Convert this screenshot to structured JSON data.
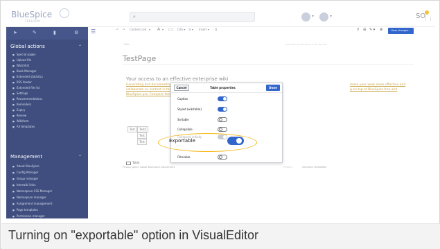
{
  "app": {
    "logo_text": "BlueSpice",
    "logo_subtext": "FREEDOM",
    "search_placeholder": "",
    "user_initials": "SO"
  },
  "sidebar": {
    "global_actions_heading": "Global actions",
    "global_items": [
      "Special pages",
      "Upload file",
      "Watchlist",
      "Book Manager",
      "Extended statistics",
      "RSS feeder",
      "Extended file list",
      "Settings",
      "Recommendations",
      "Reminders",
      "Expiry",
      "Review",
      "Wikifarm",
      "All templates"
    ],
    "management_heading": "Management",
    "management_items": [
      "About BlueSpice",
      "Config Manager",
      "Group manager",
      "Interwiki links",
      "Namespace CSS Manager",
      "Namespace manager",
      "Assignment management",
      "Page templates",
      "Permission manager"
    ]
  },
  "toolbar": {
    "items": [
      "↶",
      "↷",
      "Content cell",
      "▾",
      "A",
      "▾",
      "⊏⊐",
      "Cite ▾",
      "☰ ▾",
      "Insert ▾",
      "Ω"
    ],
    "right_items": [
      "?",
      "☰",
      "✎ ▾",
      "⊗"
    ],
    "save_label": "Save changes..."
  },
  "page": {
    "breadcrumb": "Main",
    "meta_right": "last edited by WikiSysop   4 min ago   Edit",
    "title": "TestPage",
    "heading": "Your access to an effective enterprise wiki",
    "para_lines": [
      "Generating and documenting kno",
      "collaborate on content in teams.",
      "BlueSpice pro.  Compare them all"
    ],
    "para_right_lines": [
      "make your work more effective and",
      "g on top of BlueSpice free and"
    ],
    "table_cells": [
      "Test",
      "Test2",
      "Test",
      "Test"
    ],
    "table_tool_label": "Table",
    "footer_left": "Privacy policy   About BlueSpice   Disclaimers",
    "footer_right1": "Privacy",
    "footer_right2": "Semantic MediaWiki"
  },
  "dialog": {
    "cancel_label": "Cancel",
    "title": "Table properties",
    "done_label": "Done",
    "options": [
      {
        "label": "Caption",
        "state": "on"
      },
      {
        "label": "Styled (wikitable)",
        "state": "on"
      },
      {
        "label": "Sortable",
        "state": "off"
      },
      {
        "label": "Collapsible",
        "state": "off"
      },
      {
        "label": "Collapsed initially",
        "state": "dim"
      },
      {
        "label": "Filterable",
        "state": "off"
      }
    ]
  },
  "highlight": {
    "label": "Exportable",
    "state": "on",
    "accent_color": "#f5b819"
  },
  "caption": "Turning on \"exportable\" option in VisualEditor",
  "colors": {
    "sidebar_bg": "#3f4e7e",
    "primary_blue": "#3366cc",
    "link_gold": "#c9a74c"
  }
}
